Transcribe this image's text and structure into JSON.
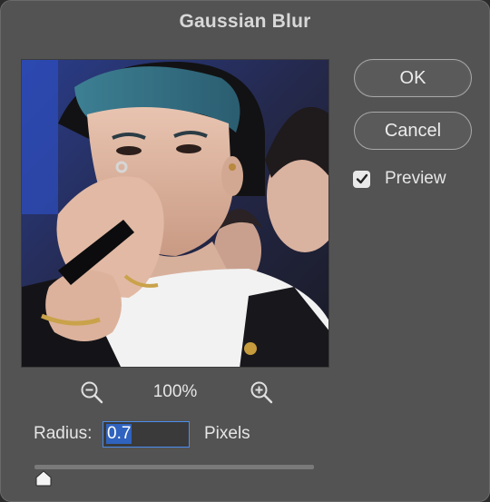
{
  "dialog": {
    "title": "Gaussian Blur"
  },
  "buttons": {
    "ok_label": "OK",
    "cancel_label": "Cancel"
  },
  "preview": {
    "label": "Preview",
    "checked": true
  },
  "zoom": {
    "level": "100%",
    "zoom_out_icon": "zoom-out-magnifier-icon",
    "zoom_in_icon": "zoom-in-magnifier-icon"
  },
  "radius": {
    "label": "Radius:",
    "value": "0.7",
    "units": "Pixels",
    "slider_fraction": 0.0
  },
  "colors": {
    "dialog_bg": "#535353",
    "input_focus": "#4a8df0",
    "selection": "#2f63bf"
  }
}
